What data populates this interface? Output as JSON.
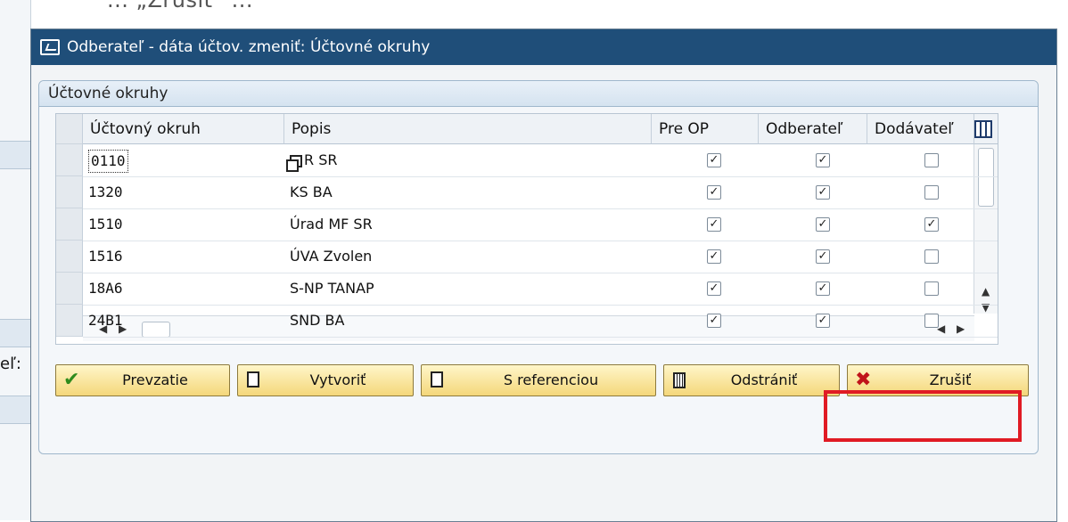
{
  "background": {
    "caption": "... „Zrušiť“ ...",
    "left_label": "eľ:"
  },
  "dialog": {
    "title": "Odberateľ - dáta účtov. zmeniť: Účtovné okruhy",
    "group_title": "Účtovné okruhy"
  },
  "table": {
    "columns": [
      "Účtovný okruh",
      "Popis",
      "Pre OP",
      "Odberateľ",
      "Dodávateľ"
    ],
    "rows": [
      {
        "code": "0110",
        "desc": "R SR",
        "pre_op": true,
        "odberatel": true,
        "dodavatel": false,
        "focused": true
      },
      {
        "code": "1320",
        "desc": "KS BA",
        "pre_op": true,
        "odberatel": true,
        "dodavatel": false
      },
      {
        "code": "1510",
        "desc": "Úrad MF SR",
        "pre_op": true,
        "odberatel": true,
        "dodavatel": true
      },
      {
        "code": "1516",
        "desc": "ÚVA Zvolen",
        "pre_op": true,
        "odberatel": true,
        "dodavatel": false
      },
      {
        "code": "18A6",
        "desc": "S-NP TANAP",
        "pre_op": true,
        "odberatel": true,
        "dodavatel": false
      },
      {
        "code": "24B1",
        "desc": "SND BA",
        "pre_op": true,
        "odberatel": true,
        "dodavatel": false
      }
    ]
  },
  "buttons": {
    "prevzatie": "Prevzatie",
    "vytvorit": "Vytvoriť",
    "s_referenciou": "S referenciou",
    "odstranit": "Odstrániť",
    "zrusit": "Zrušiť"
  },
  "colors": {
    "titlebar": "#1f4e79",
    "button_fill": "#f4d77a",
    "highlight": "#e01b24"
  },
  "icons": {
    "title": "window-icon",
    "settings": "table-settings-icon",
    "prevzatie": "checkmark-icon",
    "vytvorit": "document-icon",
    "s_referenciou": "document-icon",
    "odstranit": "trash-icon",
    "zrusit": "cancel-x-icon"
  }
}
